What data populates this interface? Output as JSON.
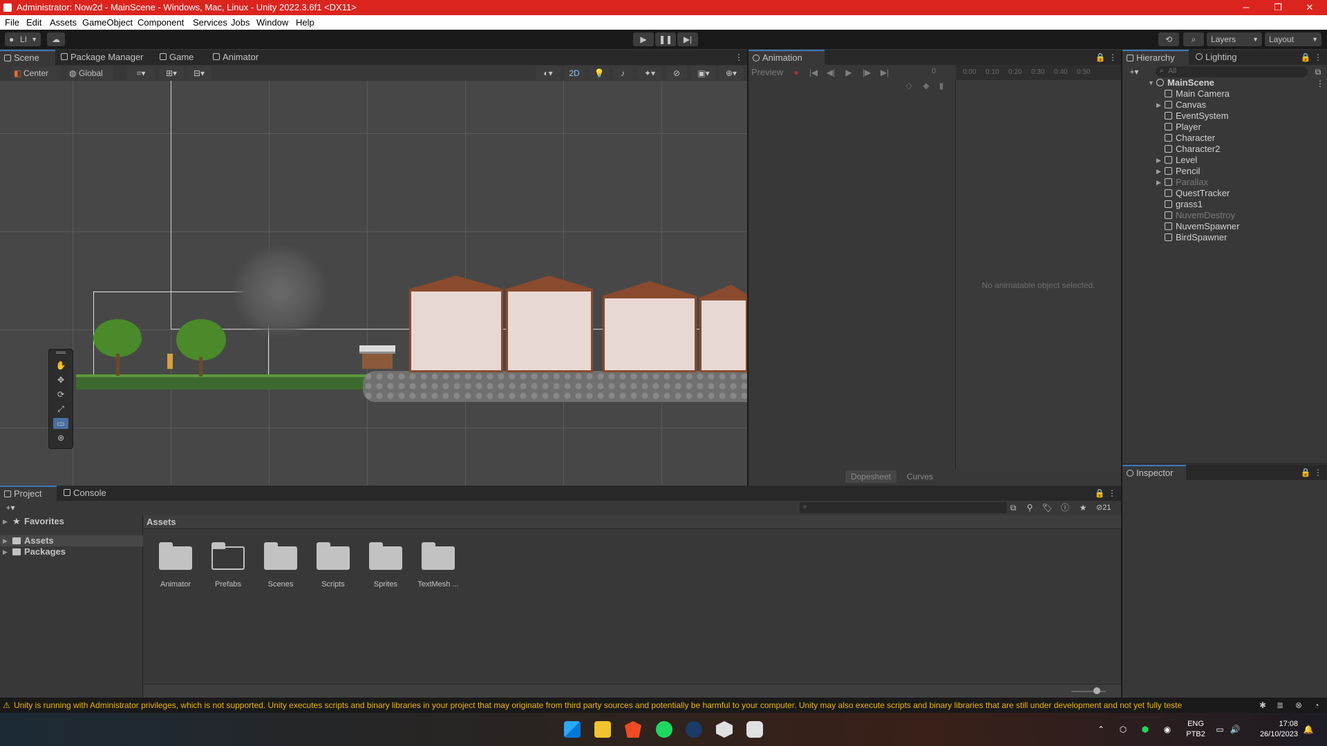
{
  "window": {
    "title": "Administrator: Now2d - MainScene - Windows, Mac, Linux - Unity 2022.3.6f1 <DX11>",
    "controls": [
      "─",
      "❐",
      "✕"
    ]
  },
  "menu": [
    "File",
    "Edit",
    "Assets",
    "GameObject",
    "Component",
    "Services",
    "Jobs",
    "Window",
    "Help"
  ],
  "toolbar": {
    "account_label": "LI",
    "layers_label": "Layers",
    "layout_label": "Layout"
  },
  "scene_tabs": [
    "Scene",
    "Package Manager",
    "Game",
    "Animator"
  ],
  "scene_toolbar": {
    "pivot_label": "Center",
    "space_label": "Global",
    "mode_2d": "2D"
  },
  "animation": {
    "tab": "Animation",
    "preview_label": "Preview",
    "frame_value": "0",
    "timeline_ticks": [
      "0:00",
      "0:10",
      "0:20",
      "0:30",
      "0:40",
      "0:50"
    ],
    "empty_message": "No animatable object selected.",
    "dopesheet_label": "Dopesheet",
    "curves_label": "Curves"
  },
  "hierarchy": {
    "tabs": [
      "Hierarchy",
      "Lighting"
    ],
    "search_placeholder": "All",
    "scene": "MainScene",
    "items": [
      {
        "label": "Main Camera",
        "expandable": false,
        "dim": false
      },
      {
        "label": "Canvas",
        "expandable": true,
        "dim": false
      },
      {
        "label": "EventSystem",
        "expandable": false,
        "dim": false
      },
      {
        "label": "Player",
        "expandable": false,
        "dim": false
      },
      {
        "label": "Character",
        "expandable": false,
        "dim": false
      },
      {
        "label": "Character2",
        "expandable": false,
        "dim": false
      },
      {
        "label": "Level",
        "expandable": true,
        "dim": false
      },
      {
        "label": "Pencil",
        "expandable": true,
        "dim": false
      },
      {
        "label": "Parallax",
        "expandable": true,
        "dim": true
      },
      {
        "label": "QuestTracker",
        "expandable": false,
        "dim": false
      },
      {
        "label": "grass1",
        "expandable": false,
        "dim": false
      },
      {
        "label": "NuvemDestroy",
        "expandable": false,
        "dim": true
      },
      {
        "label": "NuvemSpawner",
        "expandable": false,
        "dim": false
      },
      {
        "label": "BirdSpawner",
        "expandable": false,
        "dim": false
      }
    ]
  },
  "inspector": {
    "tab": "Inspector"
  },
  "project": {
    "tabs": [
      "Project",
      "Console"
    ],
    "favorites_label": "Favorites",
    "tree": [
      "Assets",
      "Packages"
    ],
    "breadcrumb": "Assets",
    "hidden_count": "21",
    "folders": [
      "Animator",
      "Prefabs",
      "Scenes",
      "Scripts",
      "Sprites",
      "TextMesh ..."
    ]
  },
  "status": {
    "warning": "Unity is running with Administrator privileges, which is not supported. Unity executes scripts and binary libraries in your project that may originate from third party sources and potentially be harmful to your computer. Unity may also execute scripts and binary libraries that are still under development and not yet fully teste"
  },
  "taskbar": {
    "lang_top": "ENG",
    "lang_bottom": "PTB2",
    "time": "17:08",
    "date": "26/10/2023"
  },
  "colors": {
    "title_bar": "#dc241f",
    "accent": "#3a79bb",
    "warning": "#f0b400"
  }
}
